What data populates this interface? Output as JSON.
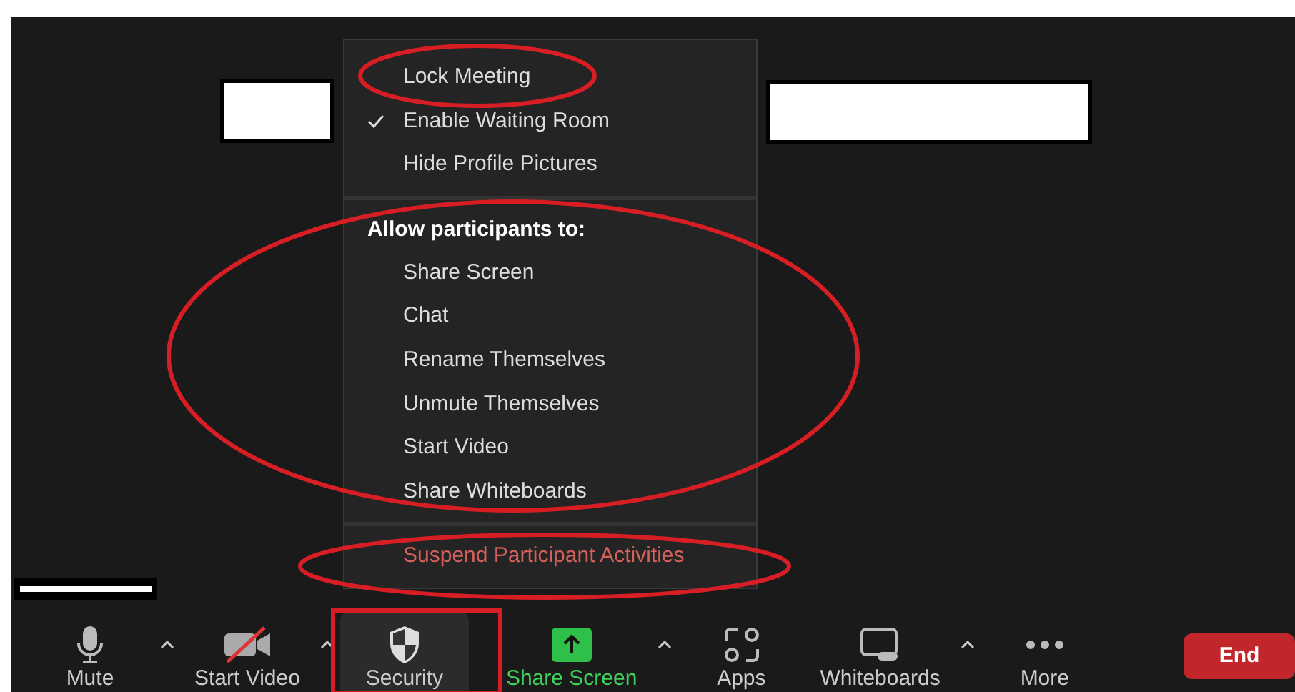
{
  "security_menu": {
    "sections": [
      {
        "items": [
          {
            "label": "Lock Meeting",
            "checked": false
          },
          {
            "label": "Enable Waiting Room",
            "checked": true
          },
          {
            "label": "Hide Profile Pictures",
            "checked": false
          }
        ]
      },
      {
        "header": "Allow participants to:",
        "items": [
          {
            "label": "Share Screen",
            "checked": false
          },
          {
            "label": "Chat",
            "checked": false
          },
          {
            "label": "Rename Themselves",
            "checked": false
          },
          {
            "label": "Unmute Themselves",
            "checked": false
          },
          {
            "label": "Start Video",
            "checked": false
          },
          {
            "label": "Share Whiteboards",
            "checked": false
          }
        ]
      },
      {
        "items": [
          {
            "label": "Suspend Participant Activities",
            "checked": false,
            "kind": "danger"
          }
        ]
      }
    ]
  },
  "toolbar": [
    {
      "label": "Mute",
      "kind": "mic",
      "caret": true,
      "selected": false
    },
    {
      "label": "Start Video",
      "kind": "video",
      "caret": true,
      "selected": false
    },
    {
      "label": "Security",
      "kind": "shield",
      "caret": false,
      "selected": true
    },
    {
      "label": "Share Screen",
      "kind": "share",
      "caret": true,
      "selected": false
    },
    {
      "label": "Apps",
      "kind": "apps",
      "caret": false,
      "selected": false
    },
    {
      "label": "Whiteboards",
      "kind": "whiteboard",
      "caret": true,
      "selected": false
    },
    {
      "label": "More",
      "kind": "more",
      "caret": false,
      "selected": false
    }
  ],
  "end_button": {
    "label": "End"
  }
}
